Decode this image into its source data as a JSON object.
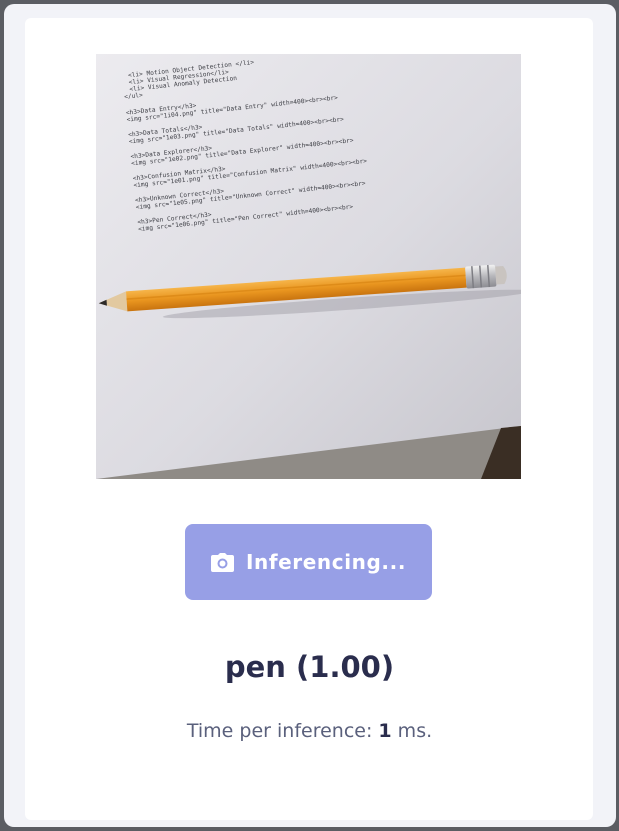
{
  "camera": {
    "label": "camera-feed",
    "paper_text": [
      "<li> Motion Object Detection </li>",
      "<li> Visual Regression</li>",
      "<li> Visual Anomaly Detection",
      "</ul>",
      "<h3>Data Entry</h3>",
      "<img src=\"1i04.png\" title=\"Data Entry\" width=400><br><br>",
      "<h3>Data Totals</h3>",
      "<img src=\"1e03.png\" title=\"Data Totals\" width=400><br><br>",
      "<h3>Data Explorer</h3>",
      "<img src=\"1e02.png\" title=\"Data Explorer\" width=400><br><br>",
      "<h3>Confusion Matrix</h3>",
      "<img src=\"1e01.png\" title=\"Confusion Matrix\" width=400><br><br>",
      "<h3>Unknown Correct</h3>",
      "<img src=\"1e05.png\" title=\"Unknown Correct\" width=400><br><br>",
      "<h3>Pen Correct</h3>",
      "<img src=\"1e06.png\" title=\"Pen Correct\" width=400><br><br>"
    ]
  },
  "button": {
    "label": "Inferencing...",
    "icon": "camera-icon",
    "color": "#979fe6"
  },
  "result": {
    "prediction": "pen (1.00)"
  },
  "timing": {
    "prefix": "Time per inference: ",
    "value": "1",
    "suffix": " ms."
  }
}
